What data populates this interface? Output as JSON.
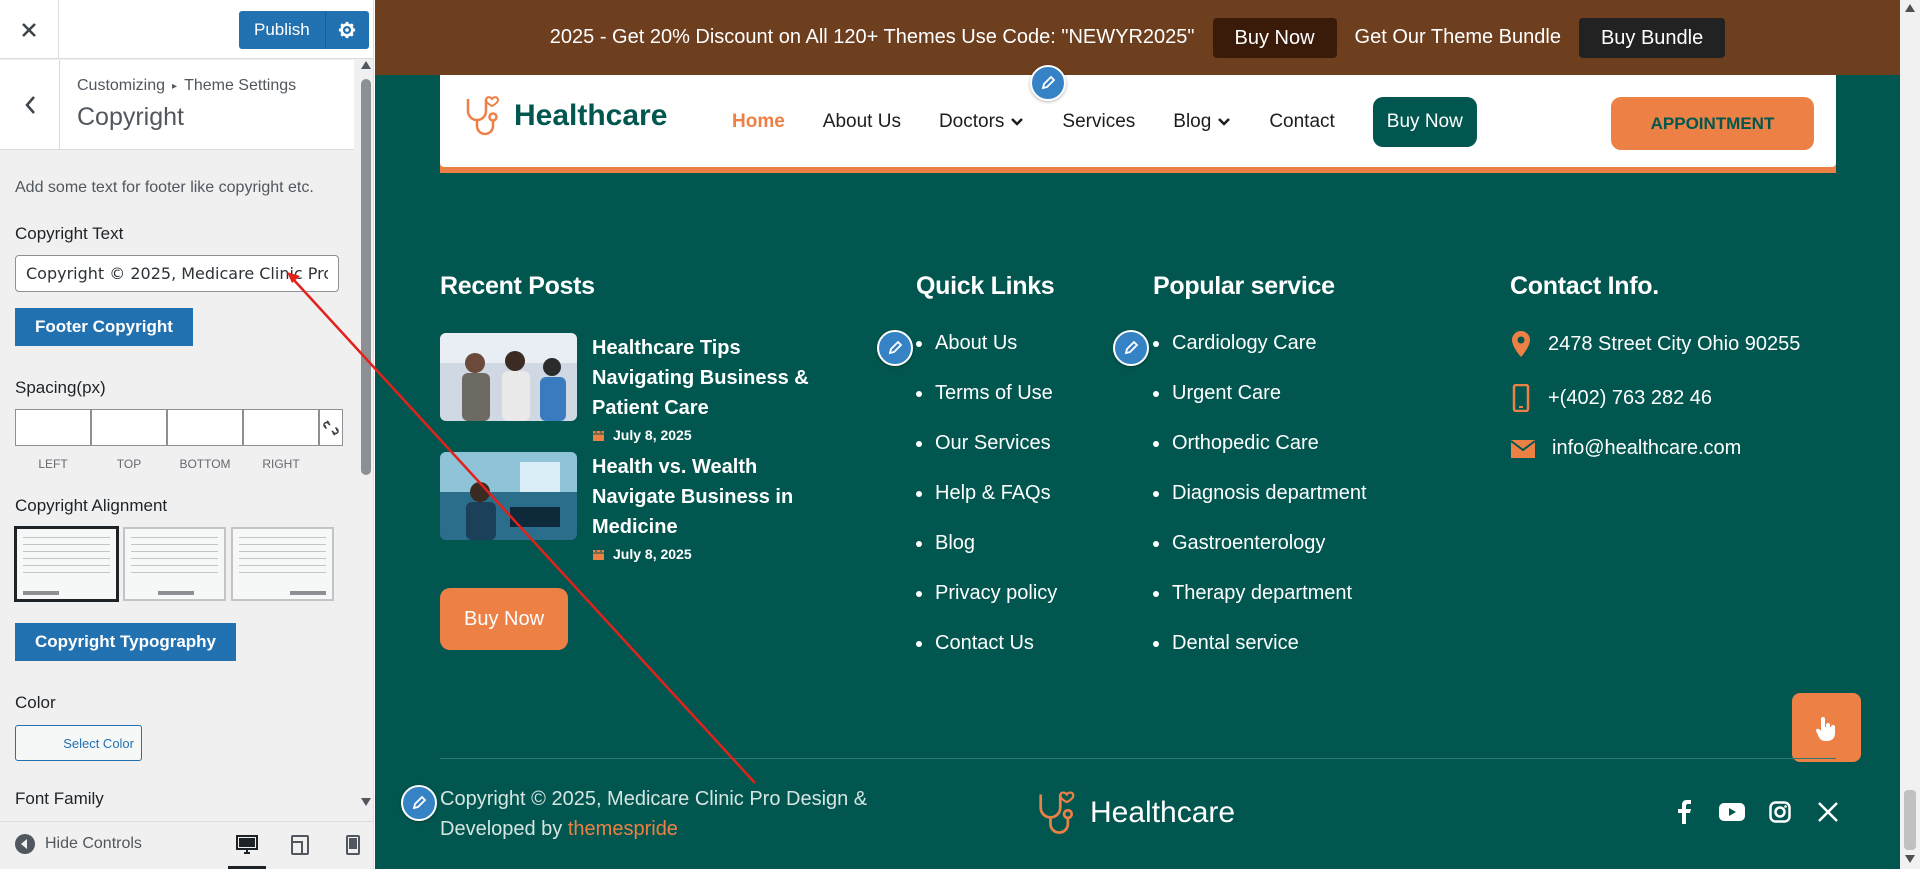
{
  "customizer": {
    "close_label": "×",
    "publish_label": "Publish",
    "breadcrumb": [
      "Customizing",
      "Theme Settings"
    ],
    "section_title": "Copyright",
    "description": "Add some text for footer like copyright etc.",
    "copyright_text_label": "Copyright Text",
    "copyright_text_value": "Copyright © 2025, Medicare Clinic Pro",
    "footer_copyright_button": "Footer Copyright",
    "spacing_label": "Spacing(px)",
    "spacing_sides": [
      "LEFT",
      "TOP",
      "BOTTOM",
      "RIGHT"
    ],
    "alignment_label": "Copyright Alignment",
    "alignment_options": [
      "left",
      "center",
      "right"
    ],
    "alignment_selected": "left",
    "typography_button": "Copyright Typography",
    "color_label": "Color",
    "select_color_label": "Select Color",
    "font_family_label": "Font Family",
    "hide_controls_label": "Hide Controls",
    "devices": [
      "desktop",
      "tablet",
      "mobile"
    ],
    "device_selected": "desktop"
  },
  "preview": {
    "promo": {
      "text": "2025 - Get 20% Discount on All 120+ Themes Use Code: \"NEWYR2025\"",
      "buy_now": "Buy Now",
      "bundle_text": "Get Our Theme Bundle",
      "buy_bundle": "Buy Bundle"
    },
    "logo_text": "Healthcare",
    "nav": [
      "Home",
      "About Us",
      "Doctors",
      "Services",
      "Blog",
      "Contact"
    ],
    "nav_buy": "Buy Now",
    "appointment": "APPOINTMENT",
    "recent_posts_heading": "Recent Posts",
    "posts": [
      {
        "title": "Healthcare Tips Navigating Business & Patient Care",
        "date": "July 8, 2025"
      },
      {
        "title": "Health vs. Wealth Navigate Business in Medicine",
        "date": "July 8, 2025"
      }
    ],
    "footer_buy": "Buy Now",
    "quick_links_heading": "Quick Links",
    "quick_links": [
      "About Us",
      "Terms of Use",
      "Our Services",
      "Help & FAQs",
      "Blog",
      "Privacy policy",
      "Contact Us"
    ],
    "popular_heading": "Popular service",
    "popular_services": [
      "Cardiology Care",
      "Urgent Care",
      "Orthopedic Care",
      "Diagnosis department",
      "Gastroenterology",
      "Therapy department",
      "Dental service"
    ],
    "contact_heading": "Contact Info.",
    "contact": {
      "address": "2478 Street City Ohio 90255",
      "phone": "+(402) 763 282 46",
      "email": "info@healthcare.com"
    },
    "copyright_main": "Copyright © 2025, Medicare Clinic Pro Design & Developed by ",
    "copyright_link": "themespride",
    "footer_logo_text": "Healthcare",
    "social": [
      "facebook-icon",
      "youtube-icon",
      "instagram-icon",
      "x-icon"
    ]
  },
  "colors": {
    "teal": "#01574f",
    "orange": "#ec8045",
    "promo_bg": "#6e3f1f",
    "wp_blue": "#2271b1"
  }
}
